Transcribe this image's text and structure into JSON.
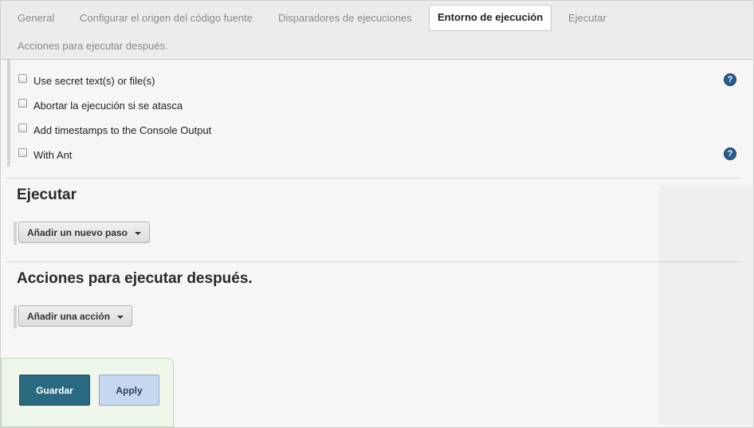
{
  "tabs": [
    {
      "label": "General",
      "active": false
    },
    {
      "label": "Configurar el origen del código fuente",
      "active": false
    },
    {
      "label": "Disparadores de ejecuciones",
      "active": false
    },
    {
      "label": "Entorno de ejecución",
      "active": true
    },
    {
      "label": "Ejecutar",
      "active": false
    },
    {
      "label": "Acciones para ejecutar después.",
      "active": false
    }
  ],
  "build_environment": {
    "options": [
      {
        "label": "Use secret text(s) or file(s)",
        "checked": false,
        "help": true
      },
      {
        "label": "Abortar la ejecución si se atasca",
        "checked": false,
        "help": false
      },
      {
        "label": "Add timestamps to the Console Output",
        "checked": false,
        "help": false
      },
      {
        "label": "With Ant",
        "checked": false,
        "help": true
      }
    ],
    "help_glyph": "?"
  },
  "build": {
    "heading": "Ejecutar",
    "add_step_label": "Añadir un nuevo paso"
  },
  "post_build": {
    "heading": "Acciones para ejecutar después.",
    "add_action_label": "Añadir una acción"
  },
  "footer": {
    "save_label": "Guardar",
    "apply_label": "Apply"
  },
  "colors": {
    "save_button": "#2a6a80",
    "apply_button": "#c6d8ef",
    "help_icon": "#2b5d8a",
    "footer_bg": "#eef7ea"
  }
}
